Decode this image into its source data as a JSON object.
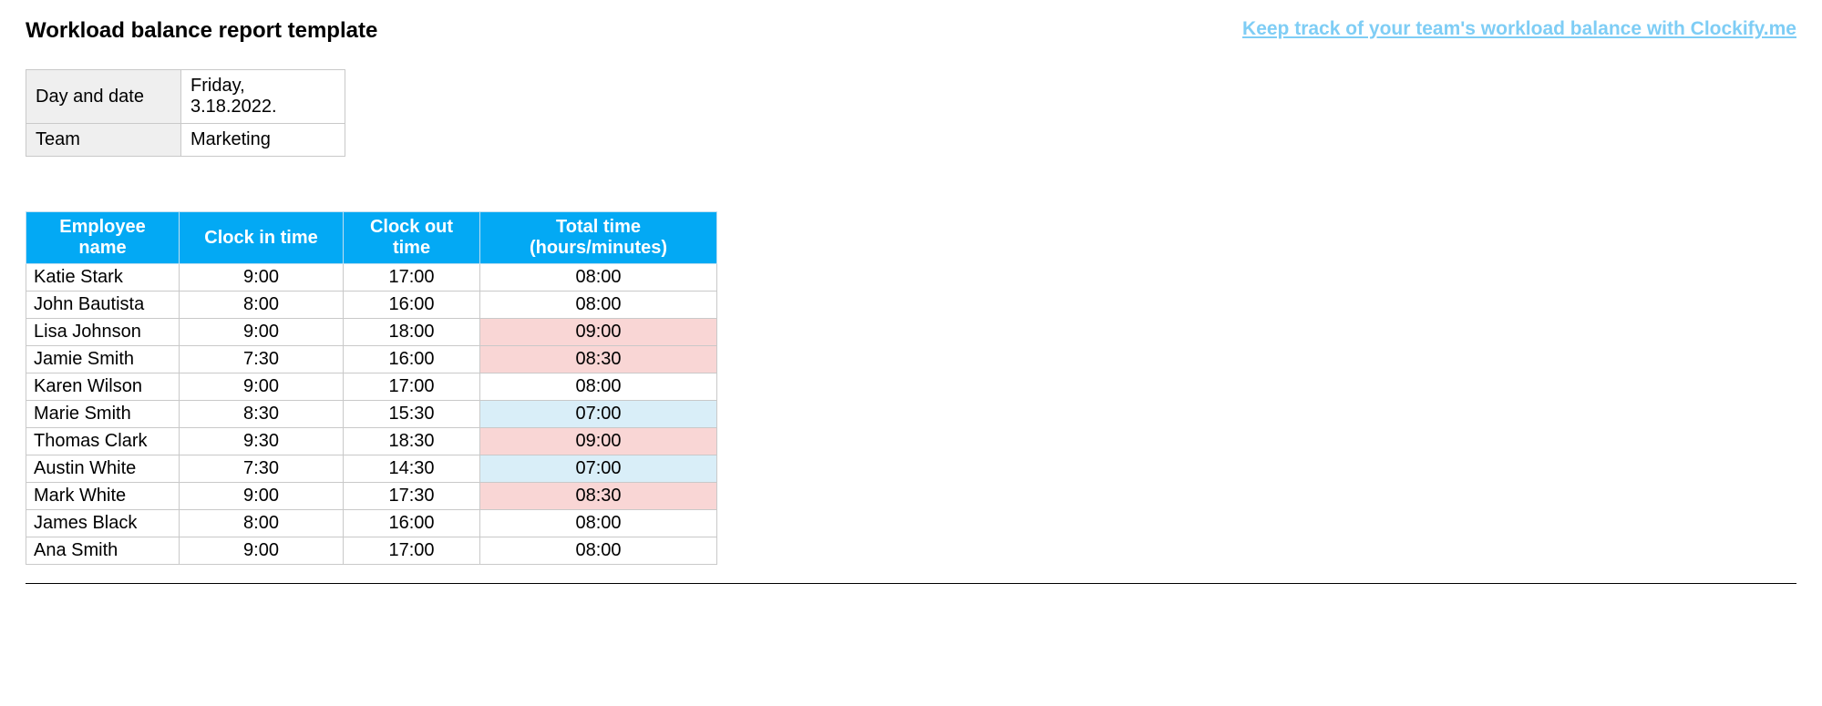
{
  "header": {
    "title": "Workload balance report template",
    "promo_link_text": "Keep track of your team's workload balance with Clockify.me"
  },
  "meta": {
    "day_label": "Day and date",
    "day_value": "Friday, 3.18.2022.",
    "team_label": "Team",
    "team_value": "Marketing"
  },
  "table": {
    "headers": {
      "name": "Employee name",
      "clock_in": "Clock in time",
      "clock_out": "Clock out time",
      "total": "Total time (hours/minutes)"
    },
    "rows": [
      {
        "name": "Katie Stark",
        "in": "9:00",
        "out": "17:00",
        "total": "08:00",
        "highlight": ""
      },
      {
        "name": "John Bautista",
        "in": "8:00",
        "out": "16:00",
        "total": "08:00",
        "highlight": ""
      },
      {
        "name": "Lisa Johnson",
        "in": "9:00",
        "out": "18:00",
        "total": "09:00",
        "highlight": "over"
      },
      {
        "name": "Jamie Smith",
        "in": "7:30",
        "out": "16:00",
        "total": "08:30",
        "highlight": "over"
      },
      {
        "name": "Karen Wilson",
        "in": "9:00",
        "out": "17:00",
        "total": "08:00",
        "highlight": ""
      },
      {
        "name": "Marie Smith",
        "in": "8:30",
        "out": "15:30",
        "total": "07:00",
        "highlight": "under"
      },
      {
        "name": "Thomas Clark",
        "in": "9:30",
        "out": "18:30",
        "total": "09:00",
        "highlight": "over"
      },
      {
        "name": "Austin White",
        "in": "7:30",
        "out": "14:30",
        "total": "07:00",
        "highlight": "under"
      },
      {
        "name": "Mark White",
        "in": "9:00",
        "out": "17:30",
        "total": "08:30",
        "highlight": "over"
      },
      {
        "name": "James Black",
        "in": "8:00",
        "out": "16:00",
        "total": "08:00",
        "highlight": ""
      },
      {
        "name": "Ana Smith",
        "in": "9:00",
        "out": "17:00",
        "total": "08:00",
        "highlight": ""
      }
    ]
  },
  "chart_data": {
    "type": "table",
    "title": "Workload balance report template",
    "columns": [
      "Employee name",
      "Clock in time",
      "Clock out time",
      "Total time (hours/minutes)"
    ],
    "rows": [
      [
        "Katie Stark",
        "9:00",
        "17:00",
        "08:00"
      ],
      [
        "John Bautista",
        "8:00",
        "16:00",
        "08:00"
      ],
      [
        "Lisa Johnson",
        "9:00",
        "18:00",
        "09:00"
      ],
      [
        "Jamie Smith",
        "7:30",
        "16:00",
        "08:30"
      ],
      [
        "Karen Wilson",
        "9:00",
        "17:00",
        "08:00"
      ],
      [
        "Marie Smith",
        "8:30",
        "15:30",
        "07:00"
      ],
      [
        "Thomas Clark",
        "9:30",
        "18:30",
        "09:00"
      ],
      [
        "Austin White",
        "7:30",
        "14:30",
        "07:00"
      ],
      [
        "Mark White",
        "9:00",
        "17:30",
        "08:30"
      ],
      [
        "James Black",
        "8:00",
        "16:00",
        "08:00"
      ],
      [
        "Ana Smith",
        "9:00",
        "17:00",
        "08:00"
      ]
    ]
  }
}
